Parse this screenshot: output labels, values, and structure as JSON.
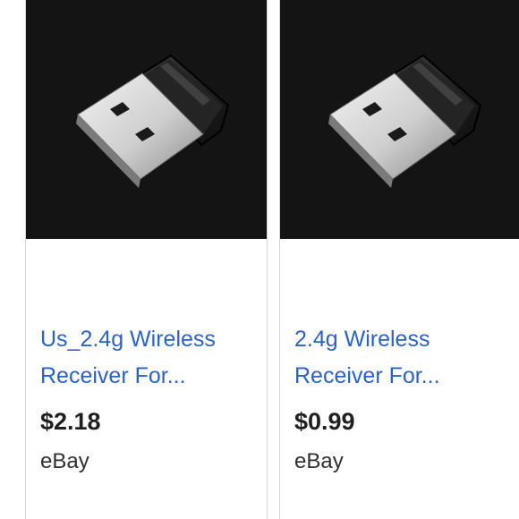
{
  "products": [
    {
      "title_line1": "Us_2.4g Wireless",
      "title_line2": "Receiver For...",
      "price": "$2.18",
      "seller": "eBay",
      "image_icon": "usb-receiver-image"
    },
    {
      "title_line1": "2.4g Wireless",
      "title_line2": "Receiver For...",
      "price": "$0.99",
      "seller": "eBay",
      "image_icon": "usb-receiver-image"
    }
  ]
}
